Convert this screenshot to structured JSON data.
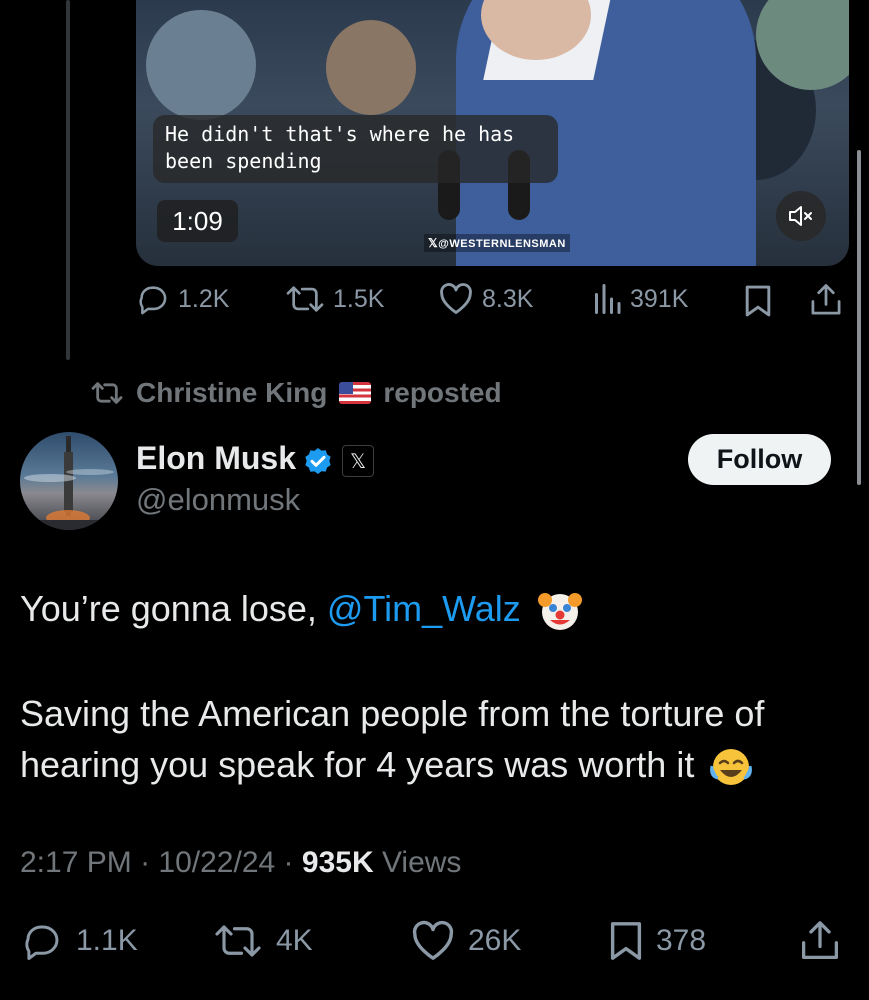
{
  "video": {
    "caption": "He didn't that's where he has been spending",
    "duration": "1:09",
    "watermark": "@WESTERNLENSMAN",
    "mute_icon": "volume-mute-icon"
  },
  "prev_actions": {
    "replies": "1.2K",
    "reposts": "1.5K",
    "likes": "8.3K",
    "views": "391K"
  },
  "repost_banner": {
    "user": "Christine King",
    "flag": "🇺🇸",
    "label": "reposted"
  },
  "author": {
    "name": "Elon Musk",
    "handle": "@elonmusk",
    "verified_color": "#1d9bf0",
    "affiliation_badge": "𝕏"
  },
  "follow_label": "Follow",
  "tweet": {
    "line1_prefix": "You’re gonna lose, ",
    "mention": "@Tim_Walz",
    "line2": "Saving the American people from the torture of hearing you speak for 4 years was worth it"
  },
  "meta": {
    "time": "2:17 PM",
    "date": "10/22/24",
    "views_count": "935K",
    "views_label": "Views",
    "separator": "·"
  },
  "actions": {
    "replies": "1.1K",
    "reposts": "4K",
    "likes": "26K",
    "bookmarks": "378"
  },
  "colors": {
    "background": "#000000",
    "accent": "#1d9bf0",
    "muted": "#71767b",
    "text": "#e7e9ea"
  }
}
